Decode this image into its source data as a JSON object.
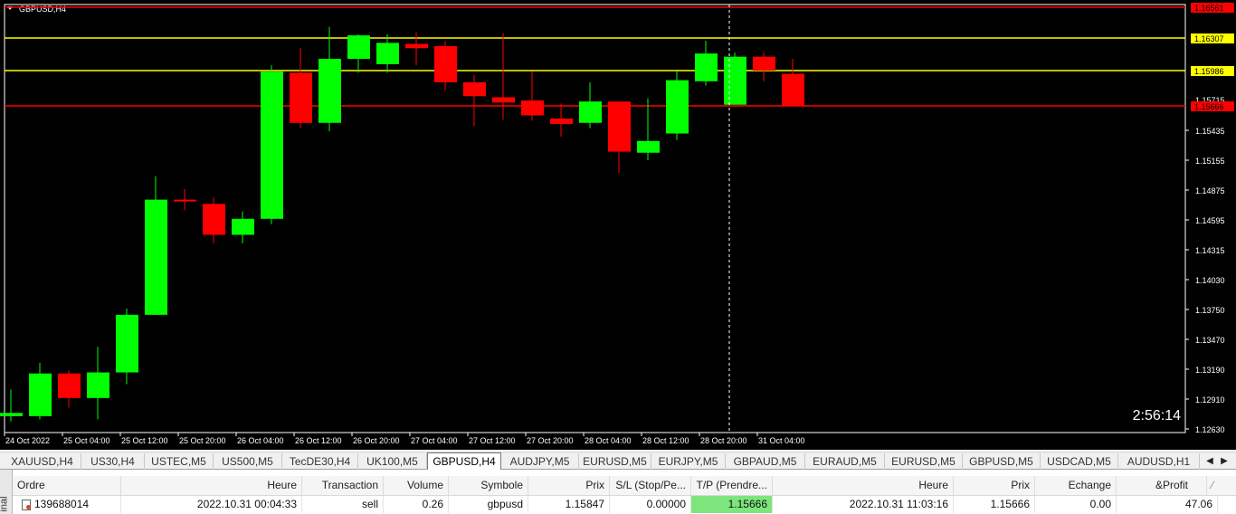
{
  "chart": {
    "symbol_title": "GBPUSD,H4",
    "countdown": "2:56:14",
    "colors": {
      "bull": "#00ff00",
      "bear": "#ff0000",
      "grid": "#ffffff",
      "background": "#000000",
      "axis_text": "#ffffff"
    },
    "price_axis": {
      "top": 1.16561,
      "ticks": [
        "1.16561",
        "1.16307",
        "1.15986",
        "1.15715",
        "1.15666",
        "1.15435",
        "1.15155",
        "1.14875",
        "1.14595",
        "1.14315",
        "1.14030",
        "1.13750",
        "1.13470",
        "1.13190",
        "1.12910",
        "1.12630"
      ]
    },
    "time_labels": [
      "24 Oct 2022",
      "25 Oct 04:00",
      "25 Oct 12:00",
      "25 Oct 20:00",
      "26 Oct 04:00",
      "26 Oct 12:00",
      "26 Oct 20:00",
      "27 Oct 04:00",
      "27 Oct 12:00",
      "27 Oct 20:00",
      "28 Oct 04:00",
      "28 Oct 12:00",
      "28 Oct 20:00",
      "31 Oct 04:00"
    ],
    "levels": [
      {
        "price": 1.16561,
        "label": "1.16561",
        "color": "#ff0000",
        "label_bg": "#ff0000"
      },
      {
        "price": 1.16307,
        "label": "1.16307",
        "color": "#ffff00",
        "label_bg": "#ffff00"
      },
      {
        "price": 1.15986,
        "label": "1.15986",
        "color": "#ffff00",
        "label_bg": "#ffff00"
      },
      {
        "price": 1.15666,
        "label": "1.15666",
        "color": "#ff0000",
        "label_bg": "#ff0000"
      }
    ],
    "candles": [
      {
        "o": 1.1275,
        "h": 1.13,
        "l": 1.127,
        "c": 1.1278
      },
      {
        "o": 1.1275,
        "h": 1.1325,
        "l": 1.1272,
        "c": 1.1315
      },
      {
        "o": 1.1315,
        "h": 1.1318,
        "l": 1.1283,
        "c": 1.1292
      },
      {
        "o": 1.1292,
        "h": 1.134,
        "l": 1.1272,
        "c": 1.1316
      },
      {
        "o": 1.1316,
        "h": 1.1376,
        "l": 1.1305,
        "c": 1.137
      },
      {
        "o": 1.137,
        "h": 1.15,
        "l": 1.137,
        "c": 1.1478
      },
      {
        "o": 1.1478,
        "h": 1.1488,
        "l": 1.1468,
        "c": 1.1477
      },
      {
        "o": 1.1474,
        "h": 1.148,
        "l": 1.1437,
        "c": 1.1445
      },
      {
        "o": 1.1445,
        "h": 1.1467,
        "l": 1.1437,
        "c": 1.146
      },
      {
        "o": 1.146,
        "h": 1.1604,
        "l": 1.1455,
        "c": 1.1598
      },
      {
        "o": 1.1597,
        "h": 1.162,
        "l": 1.1545,
        "c": 1.155
      },
      {
        "o": 1.155,
        "h": 1.164,
        "l": 1.1542,
        "c": 1.161
      },
      {
        "o": 1.161,
        "h": 1.1633,
        "l": 1.1597,
        "c": 1.1632
      },
      {
        "o": 1.1605,
        "h": 1.1633,
        "l": 1.1597,
        "c": 1.1625
      },
      {
        "o": 1.1624,
        "h": 1.1635,
        "l": 1.1604,
        "c": 1.162
      },
      {
        "o": 1.1622,
        "h": 1.1627,
        "l": 1.158,
        "c": 1.1588
      },
      {
        "o": 1.1588,
        "h": 1.1595,
        "l": 1.1547,
        "c": 1.1575
      },
      {
        "o": 1.1574,
        "h": 1.1634,
        "l": 1.1553,
        "c": 1.1569
      },
      {
        "o": 1.1571,
        "h": 1.1598,
        "l": 1.1552,
        "c": 1.1557
      },
      {
        "o": 1.1554,
        "h": 1.1568,
        "l": 1.1537,
        "c": 1.1549
      },
      {
        "o": 1.155,
        "h": 1.1588,
        "l": 1.1545,
        "c": 1.157
      },
      {
        "o": 1.157,
        "h": 1.157,
        "l": 1.1503,
        "c": 1.1523
      },
      {
        "o": 1.1522,
        "h": 1.1573,
        "l": 1.1515,
        "c": 1.1533
      },
      {
        "o": 1.154,
        "h": 1.1598,
        "l": 1.1534,
        "c": 1.159
      },
      {
        "o": 1.1589,
        "h": 1.1627,
        "l": 1.1585,
        "c": 1.1615
      },
      {
        "o": 1.1567,
        "h": 1.1616,
        "l": 1.1567,
        "c": 1.1612
      },
      {
        "o": 1.1612,
        "h": 1.1616,
        "l": 1.1589,
        "c": 1.1599
      },
      {
        "o": 1.1596,
        "h": 1.161,
        "l": 1.1566,
        "c": 1.1566
      }
    ]
  },
  "tabs": [
    "XAUUSD,H4",
    "US30,H4",
    "USTEC,M5",
    "US500,M5",
    "TecDE30,H4",
    "UK100,M5",
    "GBPUSD,H4",
    "AUDJPY,M5",
    "EURUSD,M5",
    "EURJPY,M5",
    "GBPAUD,M5",
    "EURAUD,M5",
    "EURUSD,M5",
    "GBPUSD,M5",
    "USDCAD,M5",
    "AUDUSD,H1"
  ],
  "active_tab": "GBPUSD,H4",
  "terminal": {
    "side_label": "inal",
    "headers": [
      "Ordre",
      "Heure",
      "Transaction",
      "Volume",
      "Symbole",
      "Prix",
      "S/L (Stop/Pe...",
      "T/P (Prendre...",
      "Heure",
      "Prix",
      "Echange",
      "&Profit"
    ],
    "row": [
      "139688014",
      "2022.10.31 00:04:33",
      "sell",
      "0.26",
      "gbpusd",
      "1.15847",
      "0.00000",
      "1.15666",
      "2022.10.31 11:03:16",
      "1.15666",
      "0.00",
      "47.06"
    ]
  }
}
